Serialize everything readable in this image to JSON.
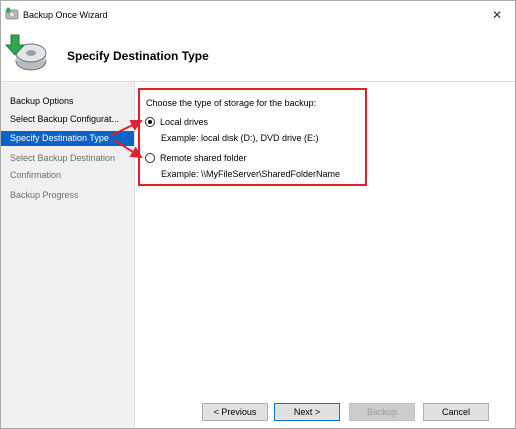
{
  "window": {
    "title": "Backup Once Wizard",
    "close_glyph": "✕",
    "icon": "backup-wizard-icon"
  },
  "header": {
    "title": "Specify Destination Type",
    "icon": "backup-disk-icon"
  },
  "sidebar": {
    "items": [
      {
        "label": "Backup Options",
        "state": "normal"
      },
      {
        "label": "Select Backup Configurat...",
        "state": "normal"
      },
      {
        "label": "Specify Destination Type",
        "state": "active"
      },
      {
        "label": "Select Backup Destination",
        "state": "disabled"
      },
      {
        "label": "Confirmation",
        "state": "disabled"
      },
      {
        "label": "Backup Progress",
        "state": "disabled"
      }
    ]
  },
  "content": {
    "prompt": "Choose the type of storage for the backup:",
    "options": [
      {
        "label": "Local drives",
        "example": "Example: local disk (D:), DVD drive (E:)",
        "checked": true
      },
      {
        "label": "Remote shared folder",
        "example": "Example: \\\\MyFileServer\\SharedFolderName",
        "checked": false
      }
    ]
  },
  "buttons": {
    "previous": "< Previous",
    "next": "Next >",
    "backup": "Backup",
    "cancel": "Cancel"
  },
  "colors": {
    "active_nav": "#0a64c8",
    "annotation": "#e0202c"
  }
}
